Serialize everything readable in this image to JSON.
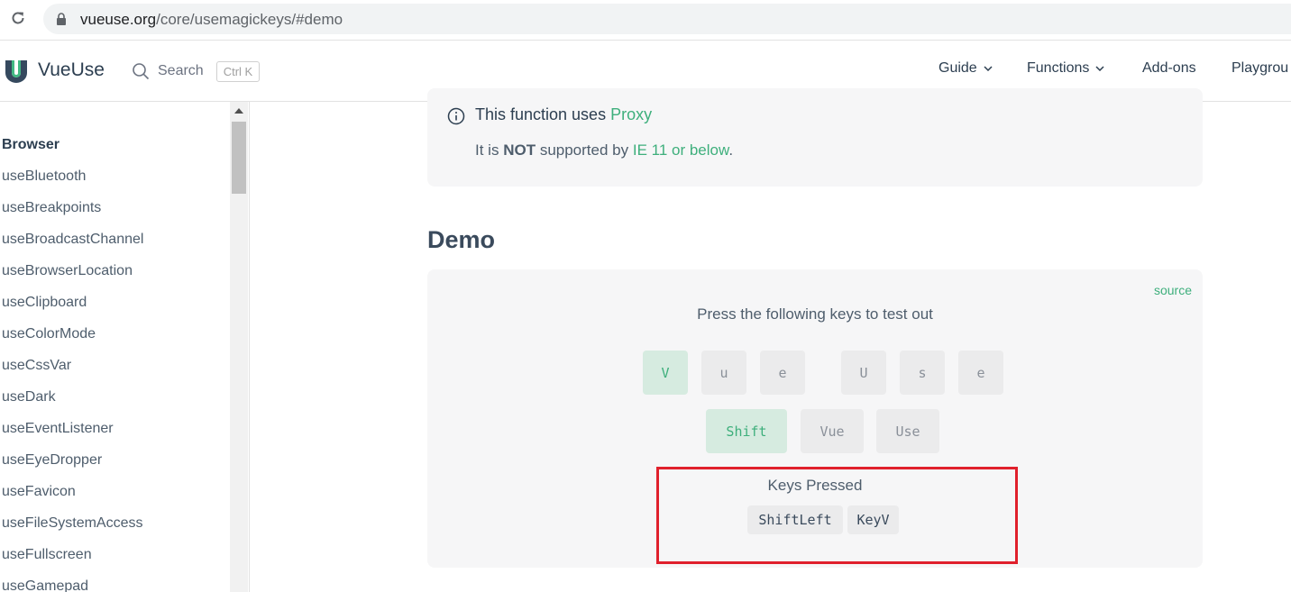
{
  "browser": {
    "url_host": "vueuse.org",
    "url_path": "/core/usemagickeys/#demo"
  },
  "nav": {
    "brand": "VueUse",
    "search_label": "Search",
    "search_shortcut": "Ctrl K",
    "links": [
      {
        "label": "Guide",
        "has_dropdown": true
      },
      {
        "label": "Functions",
        "has_dropdown": true
      },
      {
        "label": "Add-ons",
        "has_dropdown": false
      },
      {
        "label": "Playgrou",
        "has_dropdown": false
      }
    ]
  },
  "sidebar": {
    "group_title": "Browser",
    "items": [
      "useBluetooth",
      "useBreakpoints",
      "useBroadcastChannel",
      "useBrowserLocation",
      "useClipboard",
      "useColorMode",
      "useCssVar",
      "useDark",
      "useEventListener",
      "useEyeDropper",
      "useFavicon",
      "useFileSystemAccess",
      "useFullscreen",
      "useGamepad"
    ]
  },
  "tip": {
    "title_prefix": "This function uses",
    "title_link": "Proxy",
    "text_prefix": "It is",
    "text_bold": "NOT",
    "text_middle": "supported by",
    "text_link": "IE 11 or below",
    "text_suffix": "."
  },
  "demo": {
    "heading": "Demo",
    "source_label": "source",
    "instructions": "Press the following keys to test out",
    "letter_keys": [
      {
        "label": "V",
        "active": true
      },
      {
        "label": "u",
        "active": false
      },
      {
        "label": "e",
        "active": false
      },
      {
        "label": "U",
        "active": false
      },
      {
        "label": "s",
        "active": false
      },
      {
        "label": "e",
        "active": false
      }
    ],
    "combo_keys": [
      {
        "label": "Shift",
        "active": true
      },
      {
        "label": "Vue",
        "active": false
      },
      {
        "label": "Use",
        "active": false
      }
    ],
    "pressed_label": "Keys Pressed",
    "pressed_keys": [
      "ShiftLeft",
      "KeyV"
    ]
  },
  "colors": {
    "brand_green": "#3eaf7c",
    "highlight_red": "#e0202c",
    "active_key_bg": "#d6ebe0"
  }
}
